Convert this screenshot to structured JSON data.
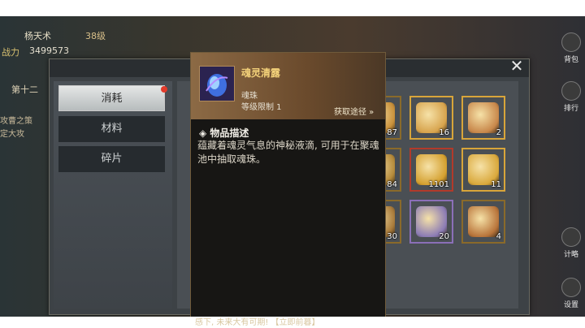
{
  "hud": {
    "player_name": "杨天术",
    "level": "38级",
    "power_label": "战力",
    "power": "3499573",
    "chapter": "第十二",
    "quest_line1": "攻曹之策",
    "quest_line2": "定大攻",
    "bottom_text": "感下, 未来大有可期! 【立即前暮】"
  },
  "side_menu": [
    {
      "label": "背包",
      "icon": "bag-icon"
    },
    {
      "label": "排行",
      "icon": "ranking-icon"
    },
    {
      "label": "计略",
      "icon": "strategy-icon"
    },
    {
      "label": "设置",
      "icon": "gear-icon"
    }
  ],
  "tabs": {
    "consumables": "消耗",
    "materials": "材料",
    "fragments": "碎片"
  },
  "items": [
    {
      "count": "87",
      "color": "#c9903a"
    },
    {
      "count": "16",
      "color": "#d7a34c"
    },
    {
      "count": "2",
      "color": "#c8874a"
    },
    {
      "count": "84",
      "color": "#b58a3a"
    },
    {
      "count": "1101",
      "color": "#d4a02f"
    },
    {
      "count": "11",
      "color": "#d9a83b"
    },
    {
      "count": "30",
      "color": "#a87a3a"
    },
    {
      "count": "20",
      "color": "#8b7bb5"
    },
    {
      "count": "4",
      "color": "#b8743a"
    }
  ],
  "tooltip": {
    "name": "魂灵清露",
    "type": "魂珠",
    "level_limit": "等级限制  1",
    "source_link": "获取途径 »",
    "desc_title": "◈ 物品描述",
    "desc": "蕴藏着魂灵气息的神秘液滴, 可用于在聚魂池中抽取魂珠。"
  }
}
